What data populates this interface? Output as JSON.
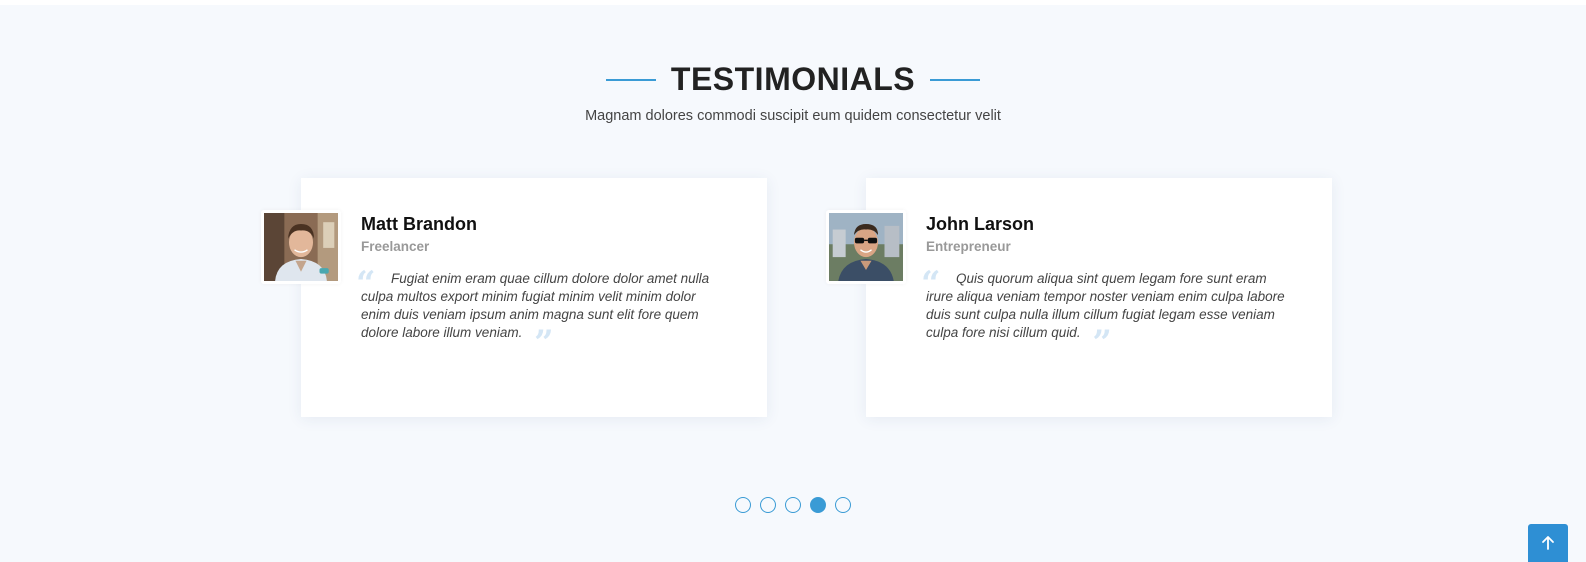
{
  "section": {
    "title": "TESTIMONIALS",
    "subtitle": "Magnam dolores commodi suscipit eum quidem consectetur velit"
  },
  "testimonials": [
    {
      "name": "Matt Brandon",
      "role": "Freelancer",
      "quote": "Fugiat enim eram quae cillum dolore dolor amet nulla culpa multos export minim fugiat minim velit minim dolor enim duis veniam ipsum anim magna sunt elit fore quem dolore labore illum veniam."
    },
    {
      "name": "John Larson",
      "role": "Entrepreneur",
      "quote": "Quis quorum aliqua sint quem legam fore sunt eram irure aliqua veniam tempor noster veniam enim culpa labore duis sunt culpa nulla illum cillum fugiat legam esse veniam culpa fore nisi cillum quid."
    }
  ],
  "pagination": {
    "total": 5,
    "active_index": 3
  },
  "icons": {
    "quote_open": "quote-left-icon",
    "quote_close": "quote-right-icon",
    "back_to_top": "arrow-up-icon"
  },
  "colors": {
    "accent": "#3a9bd5",
    "section_bg": "#f6f9fd",
    "button_bg": "#2e8fd4"
  }
}
